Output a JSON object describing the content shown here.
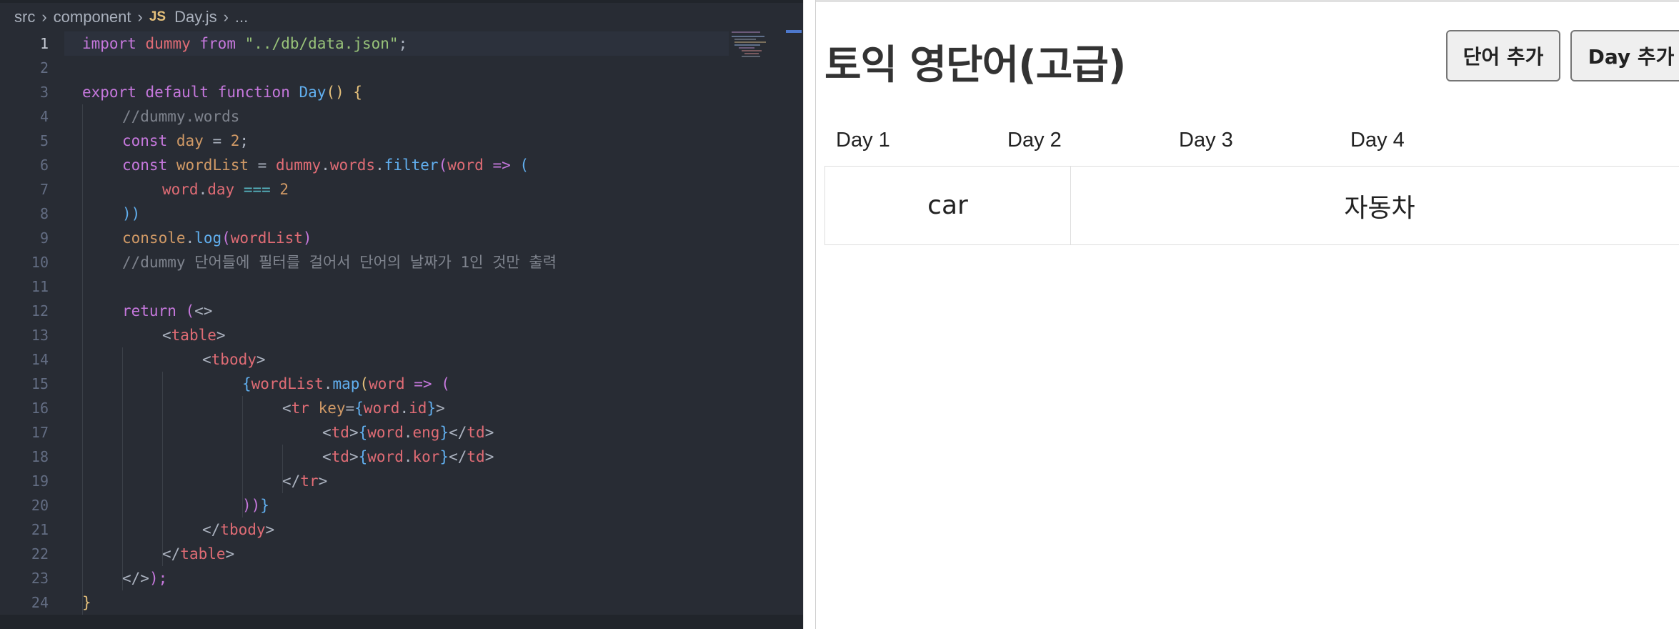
{
  "editor": {
    "breadcrumb": {
      "folder1": "src",
      "folder2": "component",
      "file_badge": "JS",
      "file_name": "Day.js",
      "symbol": "..."
    },
    "line_numbers": [
      "1",
      "2",
      "3",
      "4",
      "5",
      "6",
      "7",
      "8",
      "9",
      "10",
      "11",
      "12",
      "13",
      "14",
      "15",
      "16",
      "17",
      "18",
      "19",
      "20",
      "21",
      "22",
      "23",
      "24"
    ],
    "active_line": 1,
    "code": {
      "l1": [
        "import",
        " ",
        "dummy",
        " ",
        "from",
        " ",
        "\"../db/data.json\"",
        ";"
      ],
      "l3": [
        "export",
        " ",
        "default",
        " ",
        "function",
        " ",
        "Day",
        "()",
        " ",
        "{"
      ],
      "l4": [
        "//dummy.words"
      ],
      "l5": [
        "const",
        " ",
        "day",
        " = ",
        "2",
        ";"
      ],
      "l6": [
        "const",
        " ",
        "wordList",
        " = ",
        "dummy",
        ".",
        "words",
        ".",
        "filter",
        "(",
        "word",
        " => ",
        "("
      ],
      "l7": [
        "word",
        ".",
        "day",
        " === ",
        "2"
      ],
      "l8": [
        "))"
      ],
      "l9": [
        "console",
        ".",
        "log",
        "(",
        "wordList",
        ")"
      ],
      "l10": [
        "//dummy 단어들에 필터를 걸어서 단어의 날짜가 1인 것만 출력"
      ],
      "l12": [
        "return",
        " (",
        "<>"
      ],
      "l13": [
        "<",
        "table",
        ">"
      ],
      "l14": [
        "<",
        "tbody",
        ">"
      ],
      "l15": [
        "{",
        "wordList",
        ".",
        "map",
        "(",
        "word",
        " => ",
        "("
      ],
      "l16": [
        "<",
        "tr",
        " ",
        "key",
        "=",
        "{",
        "word",
        ".",
        "id",
        "}",
        ">"
      ],
      "l17": [
        "<",
        "td",
        ">",
        "{",
        "word",
        ".",
        "eng",
        "}",
        "</",
        "td",
        ">"
      ],
      "l18": [
        "<",
        "td",
        ">",
        "{",
        "word",
        ".",
        "kor",
        "}",
        "</",
        "td",
        ">"
      ],
      "l19": [
        "</",
        "tr",
        ">"
      ],
      "l20": [
        "))",
        "}"
      ],
      "l21": [
        "</",
        "tbody",
        ">"
      ],
      "l22": [
        "</",
        "table",
        ">"
      ],
      "l23": [
        "</>",
        ");"
      ],
      "l24": [
        "}"
      ]
    }
  },
  "preview": {
    "title": "토익 영단어(고급)",
    "buttons": {
      "add_word": "단어 추가",
      "add_day": "Day 추가"
    },
    "days": [
      "Day 1",
      "Day 2",
      "Day 3",
      "Day 4"
    ],
    "words": [
      {
        "eng": "car",
        "kor": "자동차"
      }
    ]
  },
  "colors": {
    "editor_bg": "#282c34",
    "keyword": "#c678dd",
    "function": "#61afef",
    "variable": "#e06c75",
    "number": "#d19a66",
    "string": "#98c379",
    "comment": "#7f848e",
    "bracket": "#e5c07b"
  }
}
